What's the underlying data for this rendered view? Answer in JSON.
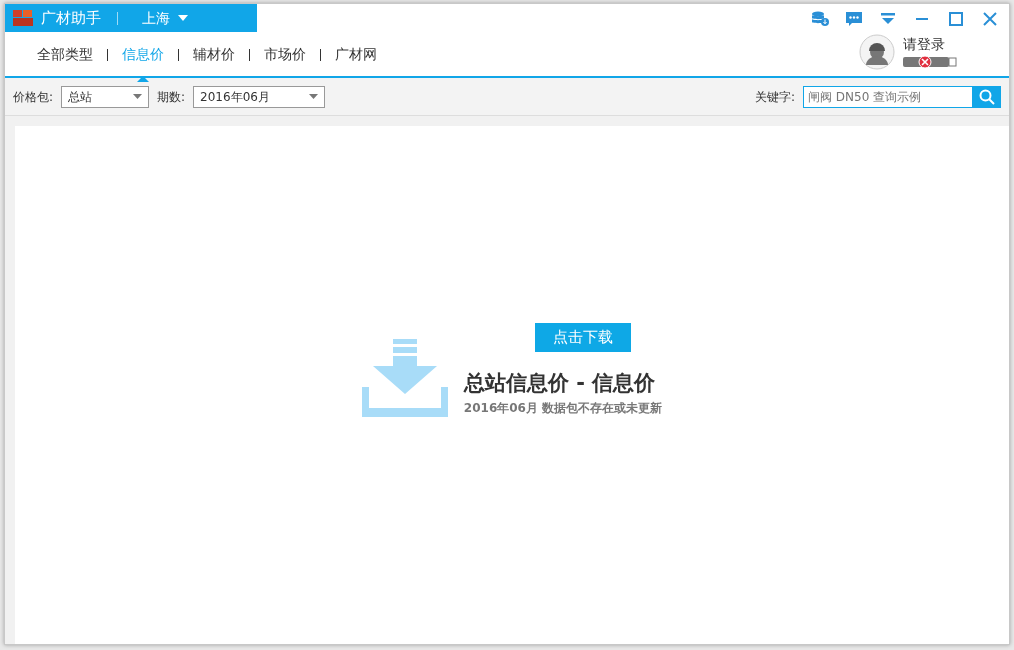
{
  "app": {
    "title": "广材助手",
    "city": "上海"
  },
  "window_controls": [
    {
      "kind": "database"
    },
    {
      "kind": "message"
    },
    {
      "kind": "dropdown"
    },
    {
      "kind": "minimize"
    },
    {
      "kind": "maximize"
    },
    {
      "kind": "close"
    }
  ],
  "user": {
    "login_label": "请登录",
    "usb_key_connected": false
  },
  "tabs": [
    {
      "label": "全部类型",
      "selected": false
    },
    {
      "label": "信息价",
      "selected": true
    },
    {
      "label": "辅材价",
      "selected": false
    },
    {
      "label": "市场价",
      "selected": false
    },
    {
      "label": "广材网",
      "selected": false
    }
  ],
  "filters": {
    "package_label": "价格包:",
    "package_value": "总站",
    "period_label": "期数:",
    "period_value": "2016年06月",
    "keyword_label": "关键字:",
    "keyword_placeholder": "闸阀 DN50 查询示例"
  },
  "empty_state": {
    "button": "点击下载",
    "title": "总站信息价 - 信息价",
    "message": "2016年06月 数据包不存在或未更新"
  }
}
